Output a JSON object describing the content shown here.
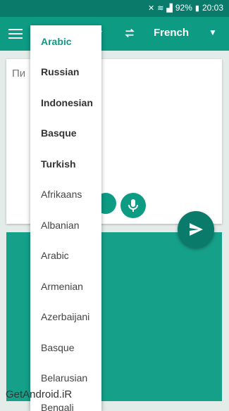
{
  "status_bar": {
    "battery": "92%",
    "time": "20:03"
  },
  "toolbar": {
    "target_language": "French"
  },
  "input": {
    "placeholder": "Пи"
  },
  "dropdown": {
    "items": [
      "Arabic",
      "Russian",
      "Indonesian",
      "Basque",
      "Turkish",
      "Afrikaans",
      "Albanian",
      "Arabic",
      "Armenian",
      "Azerbaijani",
      "Basque",
      "Belarusian",
      "Bengali"
    ]
  },
  "watermark": "GetAndroid.iR",
  "colors": {
    "primary": "#0d9b84",
    "primary_dark": "#0a7a6b",
    "output": "#15a08a"
  }
}
